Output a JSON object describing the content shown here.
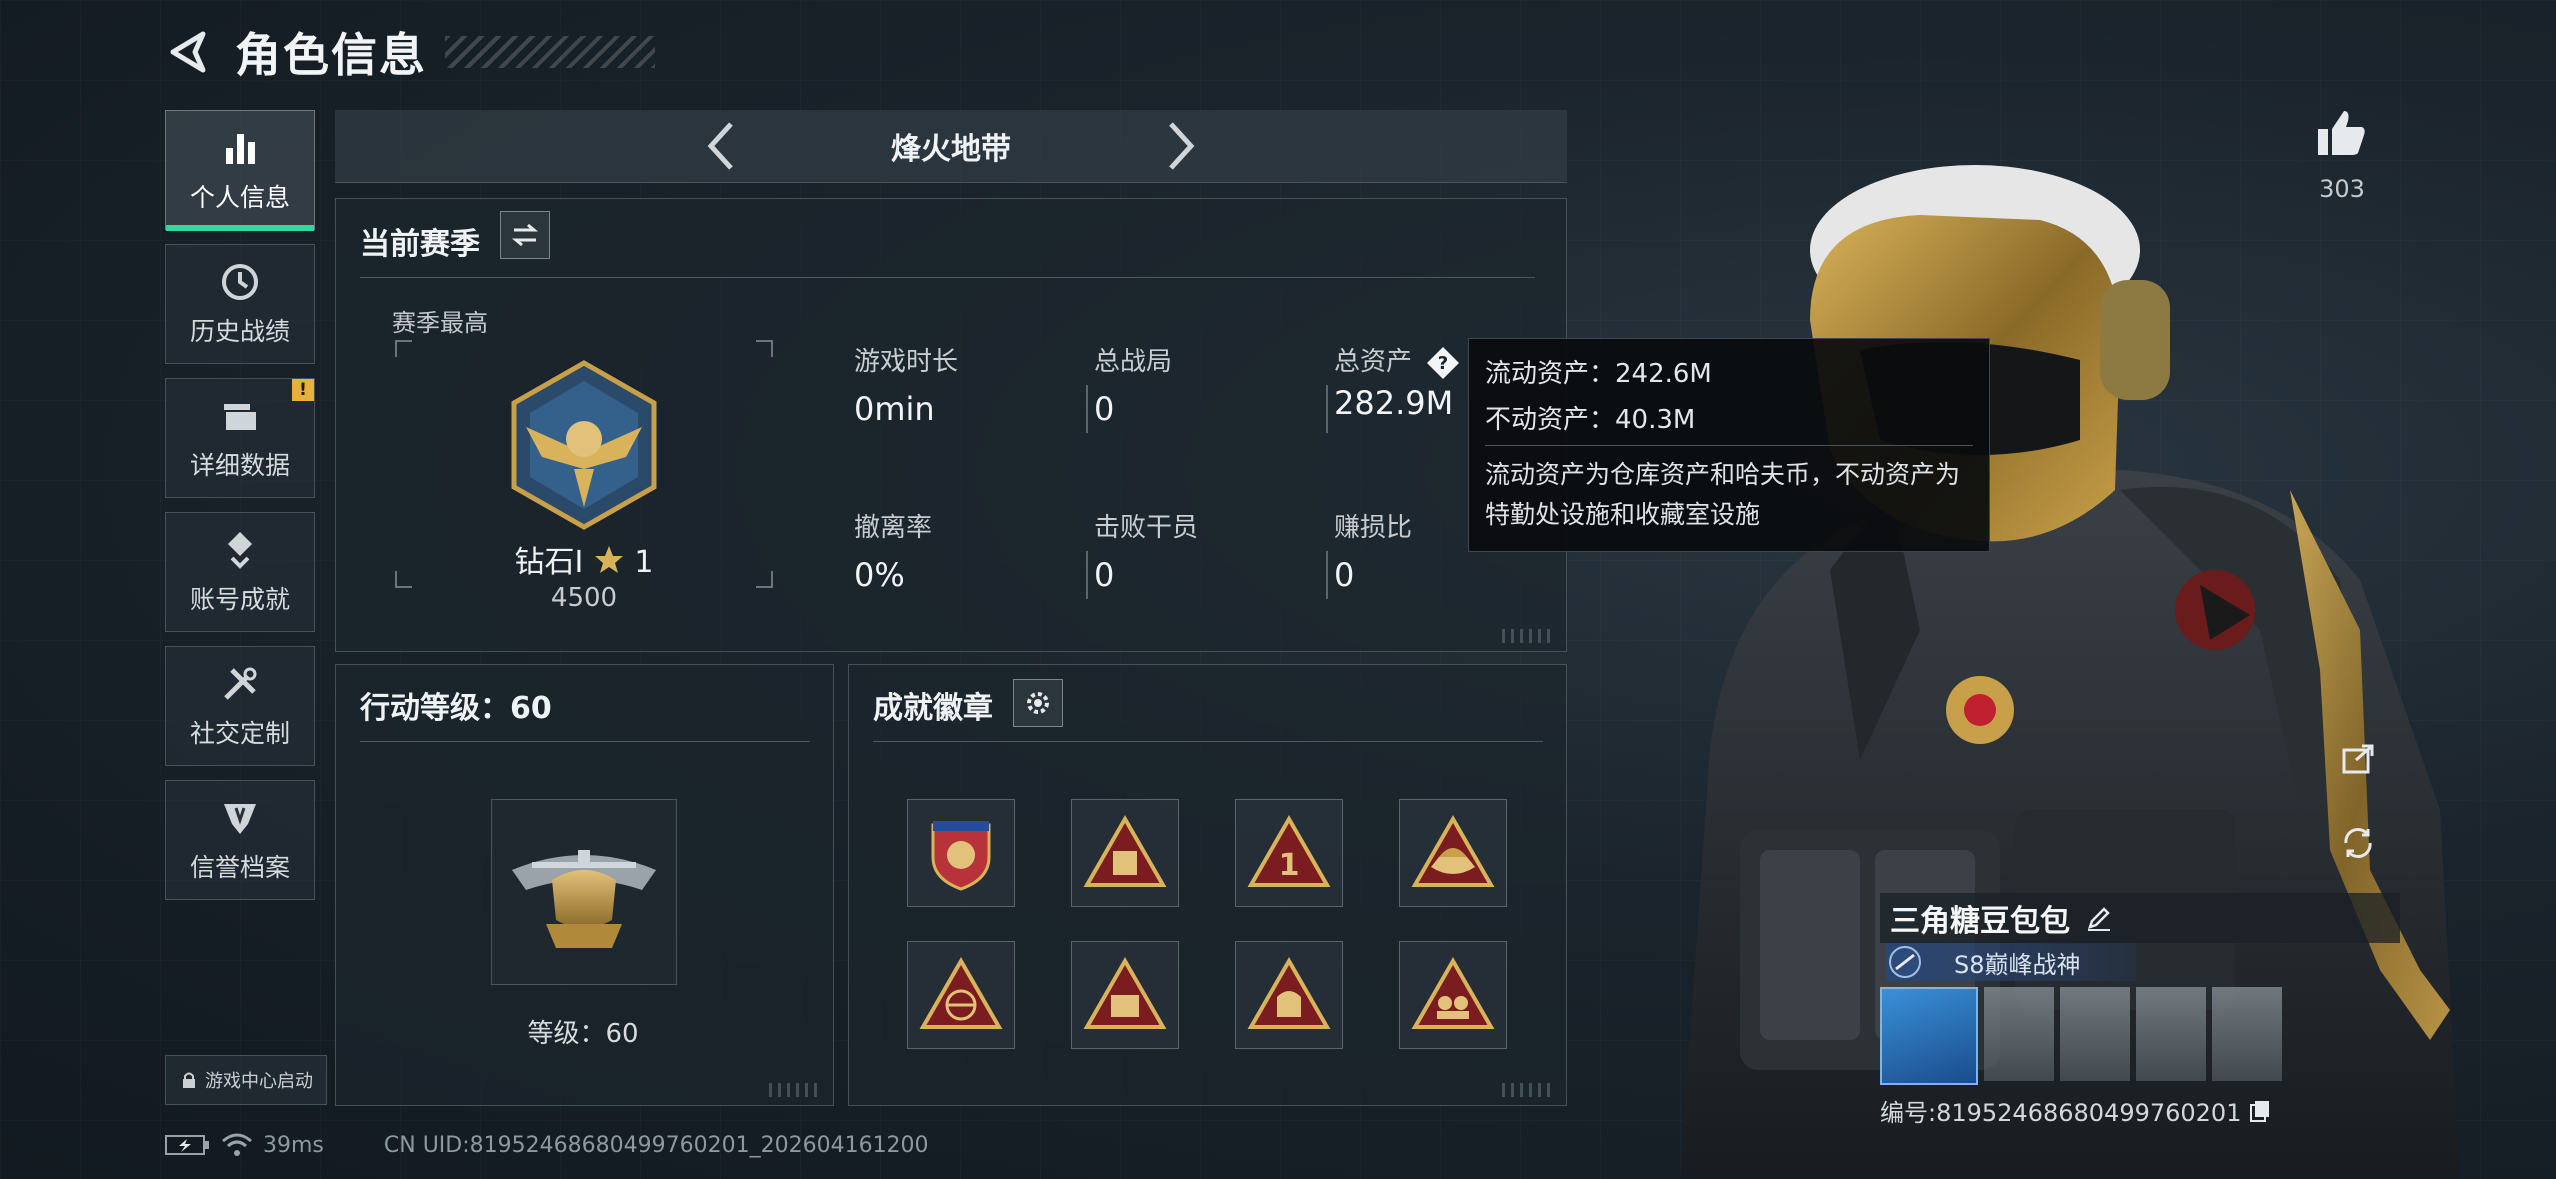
{
  "header": {
    "title": "角色信息"
  },
  "nav": {
    "items": [
      {
        "label": "个人信息",
        "active": true,
        "icon": "bar-chart-icon"
      },
      {
        "label": "历史战绩",
        "icon": "clock-icon"
      },
      {
        "label": "详细数据",
        "icon": "folder-icon",
        "badge": "!"
      },
      {
        "label": "账号成就",
        "icon": "trophy-icon"
      },
      {
        "label": "社交定制",
        "icon": "tools-icon"
      },
      {
        "label": "信誉档案",
        "icon": "shield-icon"
      }
    ],
    "launch_label": "游戏中心启动"
  },
  "status": {
    "ping": "39ms",
    "uid": "CN UID:81952468680499760201_202604161200"
  },
  "map": {
    "name": "烽火地带"
  },
  "season": {
    "title": "当前赛季",
    "subtitle": "赛季最高",
    "rank_name": "钻石I",
    "rank_stars": "1",
    "rank_points": "4500",
    "stats": [
      {
        "label": "游戏时长",
        "value": "0min"
      },
      {
        "label": "总战局",
        "value": "0"
      },
      {
        "label": "总资产",
        "value": "282.9M"
      },
      {
        "label": "撤离率",
        "value": "0%"
      },
      {
        "label": "击败干员",
        "value": "0"
      },
      {
        "label": "赚损比",
        "value": "0"
      }
    ]
  },
  "tooltip": {
    "liquid": "流动资产：242.6M",
    "fixed": "不动资产：40.3M",
    "description": "流动资产为仓库资产和哈夫币，不动资产为特勤处设施和收藏室设施"
  },
  "level": {
    "title": "行动等级：60",
    "level_text": "等级：60"
  },
  "badges": {
    "title": "成就徽章",
    "items": [
      "shield-badge-icon",
      "backpack-badge-icon",
      "number-one-badge-icon",
      "boat-badge-icon",
      "globe-badge-icon",
      "s4-badge-icon",
      "s5-badge-icon",
      "s6-badge-icon"
    ]
  },
  "likes": {
    "count": "303"
  },
  "player": {
    "name": "三角糖豆包包",
    "title": "S8巅峰战神",
    "id": "编号:81952468680499760201"
  },
  "colors": {
    "accent": "#35d7a0",
    "badge": "#e8b13a",
    "background": "#1a232b"
  }
}
